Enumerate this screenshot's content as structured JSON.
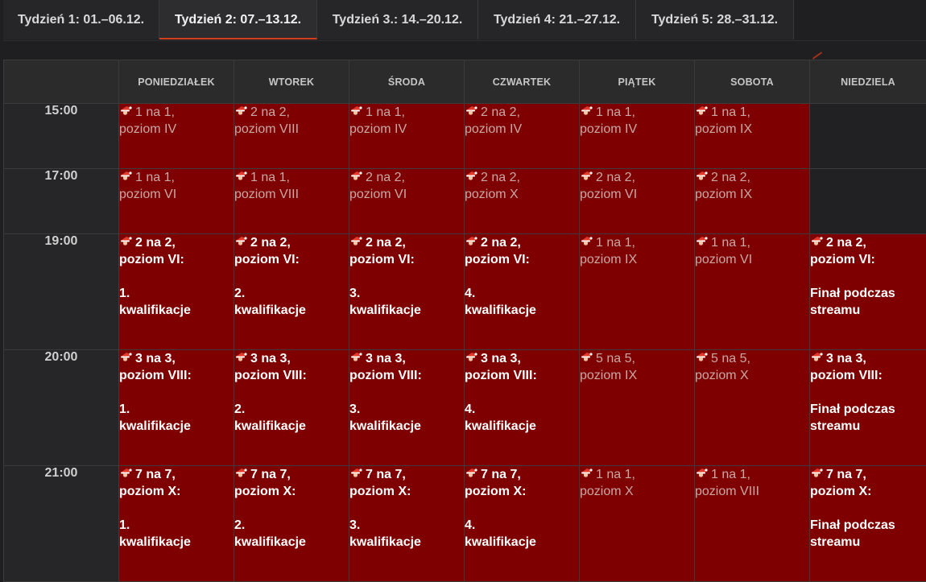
{
  "tabs": [
    {
      "label": "Tydzień 1: 01.–06.12."
    },
    {
      "label": "Tydzień 2: 07.–13.12."
    },
    {
      "label": "Tydzień 3.: 14.–20.12."
    },
    {
      "label": "Tydzień 4: 21.–27.12."
    },
    {
      "label": "Tydzień 5: 28.–31.12."
    }
  ],
  "active_tab": 1,
  "days": [
    "PONIEDZIAŁEK",
    "WTOREK",
    "ŚRODA",
    "CZWARTEK",
    "PIĄTEK",
    "SOBOTA",
    "NIEDZIELA"
  ],
  "rows": [
    {
      "time": "15:00",
      "cells": [
        {
          "line1": "1 na 1,",
          "line2": "poziom IV"
        },
        {
          "line1": "2 na 2,",
          "line2": "poziom VIII"
        },
        {
          "line1": "1 na 1,",
          "line2": "poziom IV"
        },
        {
          "line1": "2 na 2,",
          "line2": "poziom IV"
        },
        {
          "line1": "1 na 1,",
          "line2": "poziom IV"
        },
        {
          "line1": "1 na 1,",
          "line2": "poziom IX"
        },
        null
      ]
    },
    {
      "time": "17:00",
      "cells": [
        {
          "line1": "1 na 1,",
          "line2": "poziom VI"
        },
        {
          "line1": "1 na 1,",
          "line2": "poziom VIII"
        },
        {
          "line1": "2 na 2,",
          "line2": "poziom VI"
        },
        {
          "line1": "2 na 2,",
          "line2": "poziom X"
        },
        {
          "line1": "2 na 2,",
          "line2": "poziom VI"
        },
        {
          "line1": "2 na 2,",
          "line2": "poziom IX"
        },
        null
      ]
    },
    {
      "time": "19:00",
      "cells": [
        {
          "line1": "2 na 2,",
          "line2": "poziom VI:",
          "line3": "1.",
          "line4": "kwalifikacje",
          "featured": true
        },
        {
          "line1": "2 na 2,",
          "line2": "poziom VI:",
          "line3": "2.",
          "line4": "kwalifikacje",
          "featured": true
        },
        {
          "line1": "2 na 2,",
          "line2": "poziom VI:",
          "line3": "3.",
          "line4": "kwalifikacje",
          "featured": true
        },
        {
          "line1": "2 na 2,",
          "line2": "poziom VI:",
          "line3": "4.",
          "line4": "kwalifikacje",
          "featured": true
        },
        {
          "line1": "1 na 1,",
          "line2": "poziom IX"
        },
        {
          "line1": "1 na 1,",
          "line2": "poziom VI"
        },
        {
          "line1": "2 na 2,",
          "line2": "poziom VI:",
          "line3": "Finał podczas",
          "line4": "streamu",
          "featured": true
        }
      ]
    },
    {
      "time": "20:00",
      "cells": [
        {
          "line1": "3 na 3,",
          "line2": "poziom VIII:",
          "line3": "1.",
          "line4": "kwalifikacje",
          "featured": true
        },
        {
          "line1": "3 na 3,",
          "line2": "poziom VIII:",
          "line3": "2.",
          "line4": "kwalifikacje",
          "featured": true
        },
        {
          "line1": "3 na 3,",
          "line2": "poziom VIII:",
          "line3": "3.",
          "line4": "kwalifikacje",
          "featured": true
        },
        {
          "line1": "3 na 3,",
          "line2": "poziom VIII:",
          "line3": "4.",
          "line4": "kwalifikacje",
          "featured": true
        },
        {
          "line1": "5 na 5,",
          "line2": "poziom IX"
        },
        {
          "line1": "5 na 5,",
          "line2": "poziom X"
        },
        {
          "line1": "3 na 3,",
          "line2": "poziom VIII:",
          "line3": "Finał podczas",
          "line4": "streamu",
          "featured": true
        }
      ]
    },
    {
      "time": "21:00",
      "cells": [
        {
          "line1": "7 na 7,",
          "line2": "poziom X:",
          "line3": "1.",
          "line4": "kwalifikacje",
          "featured": true
        },
        {
          "line1": "7 na 7,",
          "line2": "poziom X:",
          "line3": "2.",
          "line4": "kwalifikacje",
          "featured": true
        },
        {
          "line1": "7 na 7,",
          "line2": "poziom X:",
          "line3": "3.",
          "line4": "kwalifikacje",
          "featured": true
        },
        {
          "line1": "7 na 7,",
          "line2": "poziom X:",
          "line3": "4.",
          "line4": "kwalifikacje",
          "featured": true
        },
        {
          "line1": "1 na 1,",
          "line2": "poziom X"
        },
        {
          "line1": "1 na 1,",
          "line2": "poziom VIII"
        },
        {
          "line1": "7 na 7,",
          "line2": "poziom X:",
          "line3": "Finał podczas",
          "line4": "streamu",
          "featured": true
        }
      ]
    }
  ],
  "colors": {
    "page_bg": "#1f1f21",
    "event_cell": "#7f0000",
    "empty_cell": "#212123",
    "tab_active_underline": "#d2401e",
    "muted_text": "#c9a8a8",
    "featured_text": "#ffffff"
  },
  "icons": {
    "event": "santa-icon"
  }
}
